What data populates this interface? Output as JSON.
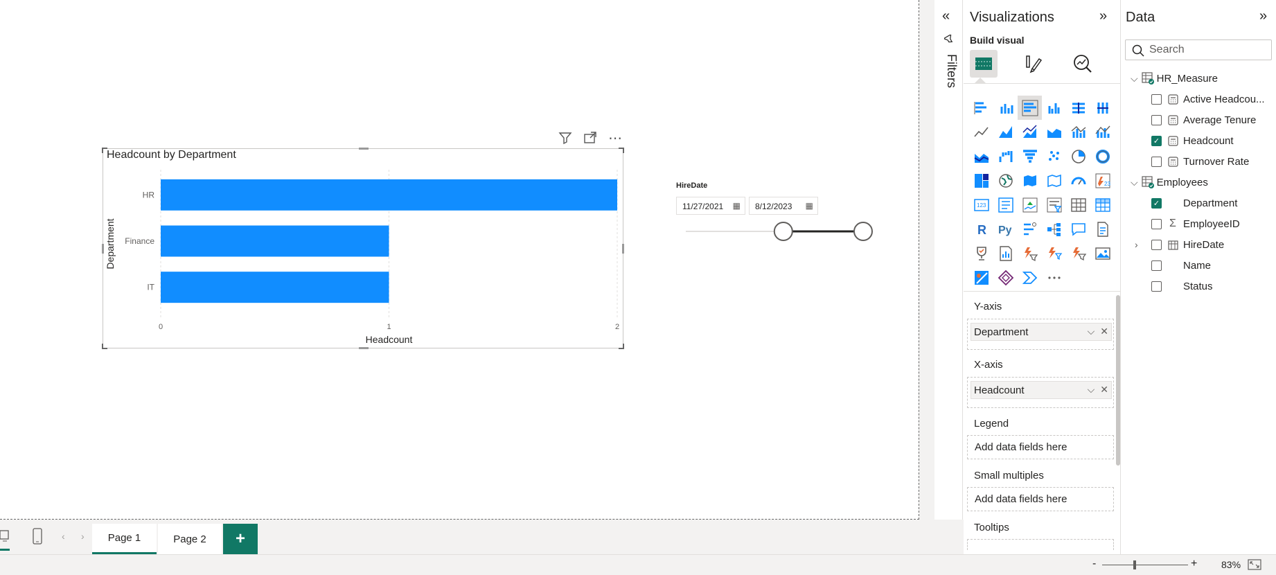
{
  "chart": {
    "title": "Headcount by Department",
    "ylabel": "Department",
    "xlabel": "Headcount",
    "bar_color": "#118DFF"
  },
  "chart_data": {
    "type": "bar",
    "orientation": "horizontal",
    "title": "Headcount by Department",
    "categories": [
      "HR",
      "Finance",
      "IT"
    ],
    "values": [
      2,
      1,
      1
    ],
    "xlabel": "Headcount",
    "ylabel": "Department",
    "xlim": [
      0,
      2
    ],
    "xticks": [
      "0",
      "1",
      "2"
    ],
    "grid": true
  },
  "slicer": {
    "title": "HireDate",
    "start_date": "11/27/2021",
    "end_date": "8/12/2023",
    "range_start_fraction": 0.55,
    "range_end_fraction": 1.0
  },
  "filters": {
    "label": "Filters"
  },
  "visualizations": {
    "title": "Visualizations",
    "build_visual": "Build visual",
    "y_axis_label": "Y-axis",
    "y_axis_field": "Department",
    "x_axis_label": "X-axis",
    "x_axis_field": "Headcount",
    "legend_label": "Legend",
    "legend_placeholder": "Add data fields here",
    "small_multiples_label": "Small multiples",
    "small_multiples_placeholder": "Add data fields here",
    "tooltips_label": "Tooltips"
  },
  "data_pane": {
    "title": "Data",
    "search_placeholder": "Search",
    "tables": [
      {
        "name": "HR_Measure",
        "fields": [
          {
            "name": "Active Headcou...",
            "checked": false,
            "icon": "calculator-icon"
          },
          {
            "name": "Average Tenure",
            "checked": false,
            "icon": "calculator-icon"
          },
          {
            "name": "Headcount",
            "checked": true,
            "icon": "calculator-icon"
          },
          {
            "name": "Turnover Rate",
            "checked": false,
            "icon": "calculator-icon"
          }
        ]
      },
      {
        "name": "Employees",
        "fields": [
          {
            "name": "Department",
            "checked": true,
            "icon": ""
          },
          {
            "name": "EmployeeID",
            "checked": false,
            "icon": "sigma-icon"
          },
          {
            "name": "HireDate",
            "checked": false,
            "icon": "calendar-icon"
          },
          {
            "name": "Name",
            "checked": false,
            "icon": ""
          },
          {
            "name": "Status",
            "checked": false,
            "icon": ""
          }
        ]
      }
    ]
  },
  "pages": {
    "tabs": [
      "Page 1",
      "Page 2"
    ],
    "active": "Page 1",
    "add_label": "+"
  },
  "status": {
    "zoom": "83%",
    "zoom_minus": "-",
    "zoom_plus": "+"
  },
  "colors": {
    "accent": "#117865",
    "bar": "#118DFF"
  }
}
